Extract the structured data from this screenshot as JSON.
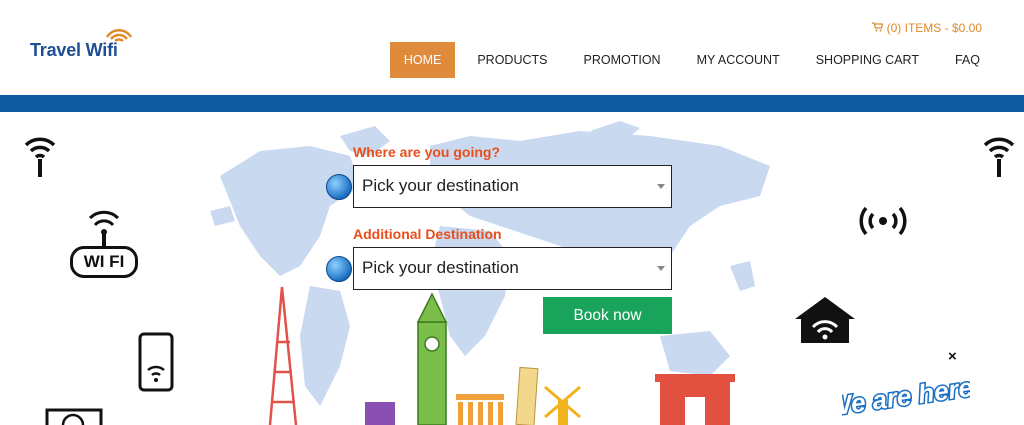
{
  "brand": {
    "name": "Travel Wifi"
  },
  "cart": {
    "summary": "(0) ITEMS - $0.00"
  },
  "nav": {
    "items": [
      {
        "label": "HOME",
        "active": true
      },
      {
        "label": "PRODUCTS"
      },
      {
        "label": "PROMOTION"
      },
      {
        "label": "MY ACCOUNT"
      },
      {
        "label": "SHOPPING CART"
      },
      {
        "label": "FAQ"
      }
    ]
  },
  "booking": {
    "destination_label": "Where are you going?",
    "destination_value": "Pick your destination",
    "additional_label": "Additional Destination",
    "additional_value": "Pick your destination",
    "book_label": "Book now"
  },
  "promo": {
    "badge_text": "We are here!",
    "close": "×"
  },
  "icons": {
    "wifi_badge_text": "WI FI"
  },
  "colors": {
    "brand_blue": "#1c4f93",
    "accent_orange": "#e08a3c",
    "bar_blue": "#0e5aa0",
    "label_red": "#e94e1b",
    "button_green": "#1aa35a"
  }
}
